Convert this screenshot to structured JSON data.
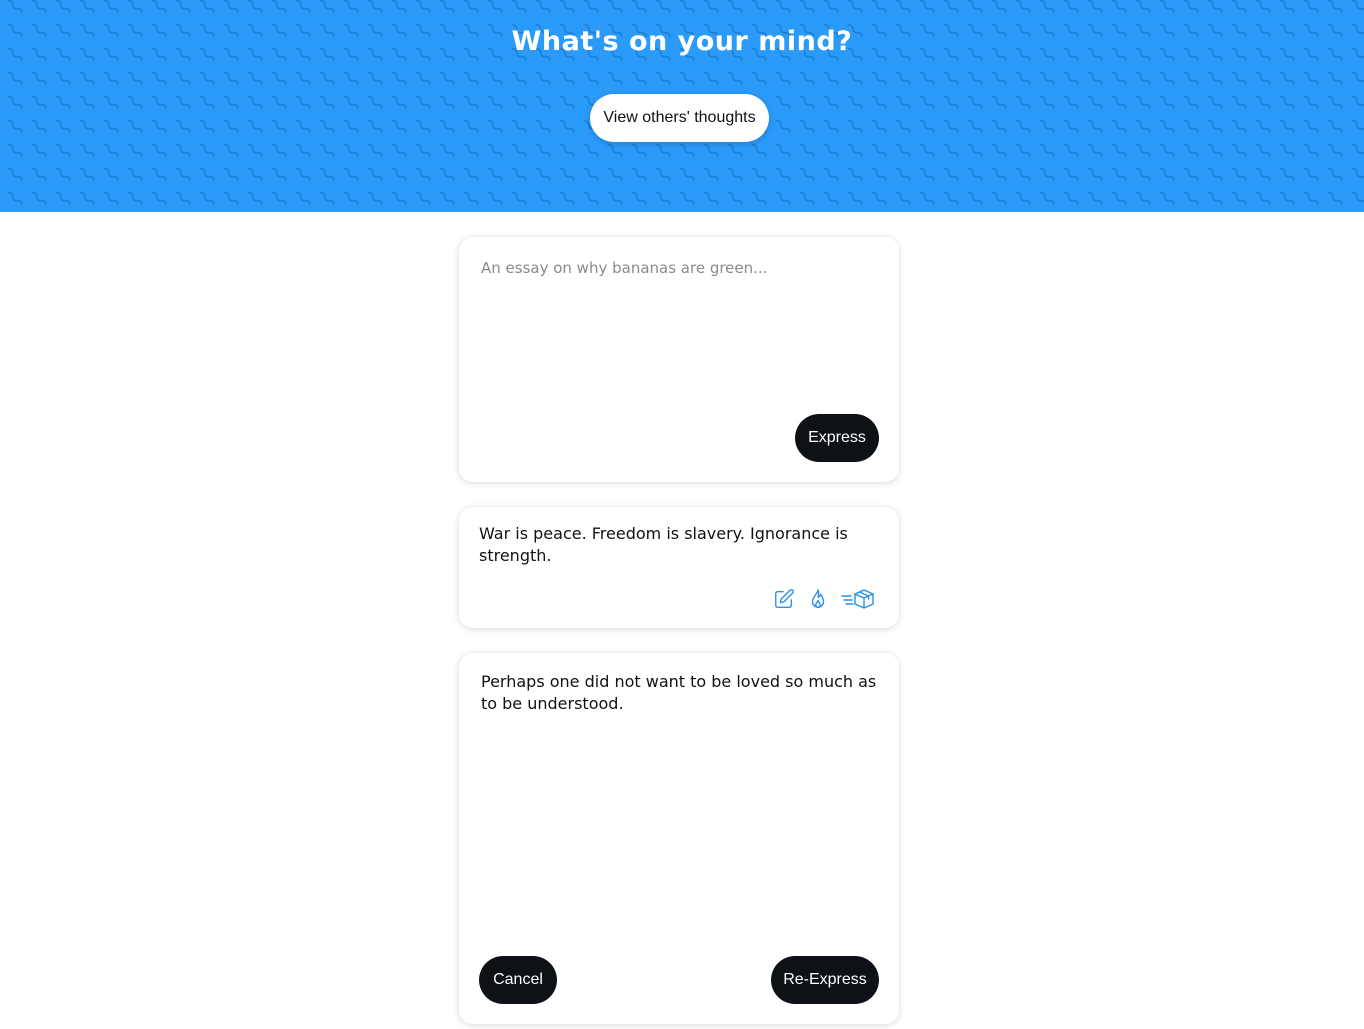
{
  "header": {
    "title": "What's on your mind?",
    "view_button_label": "View others' thoughts",
    "background_color": "#2b9bfb",
    "pattern_color": "#1d7fd3"
  },
  "compose": {
    "placeholder": "An essay on why bananas are green...",
    "value": "",
    "submit_label": "Express"
  },
  "thoughts": [
    {
      "text": "War is peace. Freedom is slavery. Ignorance is strength.",
      "actions": [
        "edit-icon",
        "fire-icon",
        "shipping-box-icon"
      ]
    }
  ],
  "editing": {
    "value": "Perhaps one did not want to be loved so much as to be understood.",
    "cancel_label": "Cancel",
    "submit_label": "Re-Express"
  },
  "colors": {
    "accent": "#2b9bfb",
    "icon": "#2a8fe8",
    "dark_button": "#0e1115"
  }
}
